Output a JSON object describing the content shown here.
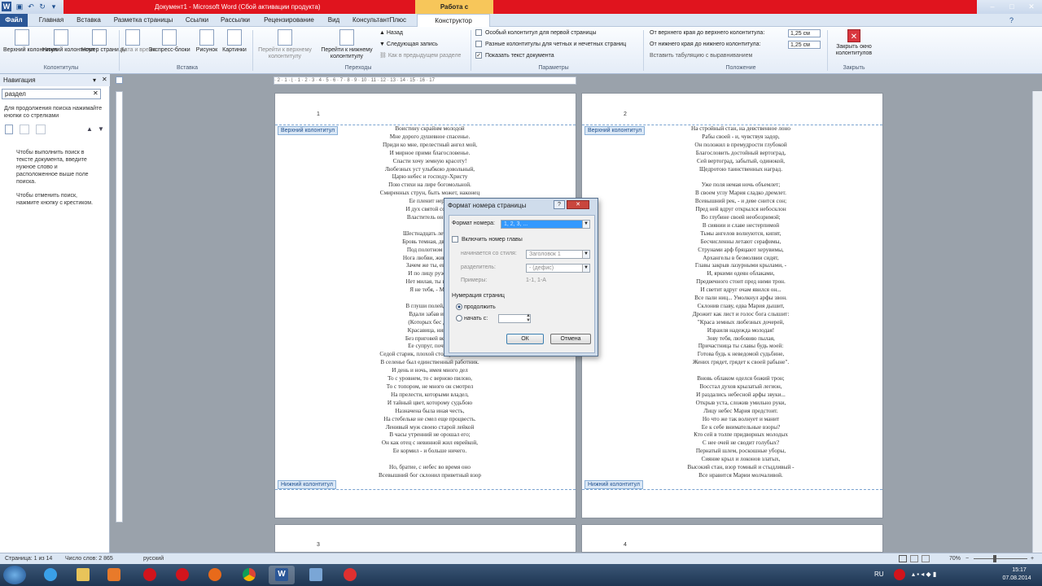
{
  "window": {
    "title": "Документ1 - Microsoft Word (Сбой активации продукта)",
    "context_tab": "Работа с колонтитулами"
  },
  "tabs": [
    "Файл",
    "Главная",
    "Вставка",
    "Разметка страницы",
    "Ссылки",
    "Рассылки",
    "Рецензирование",
    "Вид",
    "КонсультантПлюс",
    "Конструктор"
  ],
  "ribbon": {
    "header_label": "Верхний колонтитул",
    "footer_label": "Нижний колонтитул",
    "pagenum_label": "Номер страницы",
    "date_label": "Дата и время",
    "express_label": "Экспресс-блоки",
    "picture_label": "Рисунок",
    "clipart_label": "Картинки",
    "goto_header_label": "Перейти к верхнему колонтитулу",
    "goto_footer_label": "Перейти к нижнему колонтитулу",
    "prev_label": "Назад",
    "next_label": "Следующая запись",
    "link_prev_label": "Как в предыдущем разделе",
    "opt_first": "Особый колонтитул для первой страницы",
    "opt_oddeven": "Разные колонтитулы для четных и нечетных страниц",
    "opt_showtext": "Показать текст документа",
    "pos_top_label": "От верхнего края до верхнего колонтитула:",
    "pos_top_value": "1,25 см",
    "pos_bottom_label": "От нижнего края до нижнего колонтитула:",
    "pos_bottom_value": "1,25 см",
    "align_tab_label": "Вставить табуляцию с выравниванием",
    "close_label": "Закрыть окно колонтитулов",
    "groups": {
      "hf": "Колонтитулы",
      "insert": "Вставка",
      "nav": "Переходы",
      "params": "Параметры",
      "position": "Положение",
      "close": "Закрыть"
    }
  },
  "nav": {
    "title": "Навигация",
    "search_value": "раздел",
    "hint": "Для продолжения поиска нажимайте кнопки со стрелками",
    "help1": "Чтобы выполнить поиск в тексте документа, введите нужное слово и расположенное выше поле поиска.",
    "help2": "Чтобы отменить поиск, нажмите кнопку с крестиком."
  },
  "ruler_text": "· 2 · 1 · ⌊ · 1 · 2 · 3 · 4 · 5 · 6 · 7 · 8 · 9 · 10 · 11 · 12 · 13 · 14 · 15 · 16 · 17",
  "pages": {
    "header_tag": "Верхний колонтитул",
    "footer_tag": "Нижний колонтитул",
    "num1": "1",
    "num2": "2",
    "num3": "3",
    "num4": "4",
    "left_poem": [
      "Воистину скрайнм молодой",
      "Мне дорого душевное спасенье.",
      "Приди ко мне, прелестный ангел мой,",
      "И мирное прими благословенье.",
      "Спасти хочу земную красоту!",
      "Любезных уст улыбкою довольный,",
      "Царю небес и господу-Христу",
      "Пою стихи на лире богомольной.",
      "Смиренных струн, быть может, наконец",
      "Ее пленит нерцо",
      "И дух святой сойде",
      "Властитель он и м",
      "",
      "Шестнадцать лет, нев",
      "Бровь темная, двух до",
      "Под полотном упр",
      "Нога любви, живучие",
      "Зачем же ты, еврей",
      "И по лицу рузоне",
      "Нет милая, ты прав",
      "Я не тебя, - Мар",
      "",
      "В глуши полей, вда",
      "Вдали забав и не",
      "(Которых бес для",
      "Красавица, никем",
      "Без приговей веда в",
      "Ее супруг, почтен",
      "Седой старик, плохой столяр и плотник,",
      "В селенье был единственный работник.",
      "И день и ночь, имея много дел",
      "То с уровнем, то с верною пилою,",
      "То с топором, не много он смотрел",
      "На прелести, которыми владел,",
      "И тайный цвет, которому судьбою",
      "Назначена была иная честь,",
      "На стебельке не смел еще процвесть.",
      "Ленивый муж своею старой лейкой",
      "В часы утренний не орошал его;",
      "Он как отец с невинной жил еврейкой,",
      "Ее кормил - и больше ничего.",
      "",
      "Но, братие, с небес во время оно",
      "Всевышний бог склонил приветный взор"
    ],
    "right_poem": [
      "На стройный стан, на девственное лоно",
      "Рабы своей - и, чувствуя задор,",
      "Он положил в премудрости глубокой",
      "Благословить достойный вертоград,",
      "Сей вертоград, забытый, одинокой,",
      "Щедротою таинственных наград.",
      "",
      "Уже поля немая ночь объемлет;",
      "В своем углу Мария сладко дремлет.",
      "Всевышний рек, - и деве снится сон;",
      "Пред ней вдруг открылся небосклон",
      "Во глубине своей необозримой;",
      "В сиянии и славе нестерпимой",
      "Тьмы ангелов волнуются, кипят,",
      "Бесчисленны летают серафимы,",
      "Струнами арф бряцают херувимы,",
      "Архангелы в безмолвии сидят,",
      "Главы закрыв лазурными крылами, -",
      "И, яркими одеян облаками,",
      "Предвечного стоит пред ними трон.",
      "И светит вдруг очам явился он...",
      "Все пали ниц... Умолкнул арфы звон.",
      "Склонив главу, едва Мария дышит,",
      "Дрожит как лист и голос бога слышит:",
      "\"Краса земных любезных дочерей,",
      "Израиля надежда молодая!",
      "Зову тебя, любовию пылая,",
      "Причастница ты славы будь моей:",
      "Готова будь к неведомой судьбине,",
      "Жених грядет, грядет к своей рабыне\".",
      "",
      "Вновь облаком оделся божий трон;",
      "Восстал духов крылатый легион,",
      "И раздались небесной арфы звуки...",
      "Открыв уста, сложив умильно руки,",
      "Лицу небес Мария предстоит.",
      "Но что же так волнует и манит",
      "Ее к себе внимательные взоры?",
      "Кто сей в толпе придворных молодых",
      "С нее очей не сводит голубых?",
      "Пернатый шлем, роскошные уборы,",
      "Сияние крыл и локонов златых,",
      "Высокий стан, взор томный и стыдливый -",
      "Все нравится Марии молчаливой."
    ]
  },
  "dialog": {
    "title": "Формат номера страницы",
    "format_label": "Формат номера:",
    "format_value": "1, 2, 3, ...",
    "include_chapter": "Включить номер главы",
    "starts_with_label": "начинается со стиля:",
    "starts_with_value": "Заголовок 1",
    "separator_label": "разделитель:",
    "separator_value": "-   (дефис)",
    "examples_label": "Примеры:",
    "examples_value": "1-1, 1-A",
    "numbering_label": "Нумерация страниц",
    "continue_label": "продолжить",
    "start_at_label": "начать с:",
    "ok": "ОК",
    "cancel": "Отмена"
  },
  "status": {
    "page": "Страница: 1 из 14",
    "words": "Число слов: 2 865",
    "lang": "русский",
    "zoom": "70%"
  },
  "taskbar": {
    "lang": "RU",
    "time": "15:17",
    "date": "07.08.2014"
  },
  "colors": {
    "accent": "#2b5797",
    "activation_bar": "#e0141e",
    "context_tab": "#f7c65a"
  }
}
